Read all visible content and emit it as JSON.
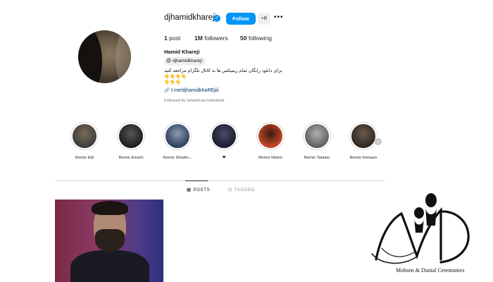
{
  "profile": {
    "username": "djhamidkhareji",
    "verified_mark": "✓",
    "follow_label": "Follow",
    "suggest_label": "+R",
    "more_label": "•••",
    "stats": {
      "posts_value": "1",
      "posts_label": "post",
      "followers_value": "1M",
      "followers_label": "followers",
      "following_value": "50",
      "following_label": "following"
    },
    "full_name": "Hamid Khareji",
    "threads_handle": "djhamidkhareji",
    "bio": "برای دانلود رایگان تمام ریمیکس ها به کانال تلگرام مراجعه کنید\n👇👇👇👇\n👇👇👇",
    "link": "t.me/djhamidkhaREjiii",
    "followed_by": "Followed by leilashirazi.hairstylist"
  },
  "highlights": [
    {
      "label": "Remix Ebi",
      "colors": [
        "#3a3a3a",
        "#7a6a5a"
      ]
    },
    {
      "label": "Remix Emarh",
      "colors": [
        "#1a1a1a",
        "#555555"
      ]
    },
    {
      "label": "Remix Shadm...",
      "colors": [
        "#2a3a5a",
        "#8a9ab0"
      ]
    },
    {
      "label": "❤",
      "colors": [
        "#1a1a2a",
        "#4a4a6a"
      ]
    },
    {
      "label": "Remix Moein",
      "colors": [
        "#d04a2a",
        "#3a1a10"
      ]
    },
    {
      "label": "Remix Tataloo",
      "colors": [
        "#5a5a5a",
        "#b0b0b0"
      ]
    },
    {
      "label": "Remix homaun",
      "colors": [
        "#2a2420",
        "#6a5a4a"
      ]
    }
  ],
  "tabs": {
    "posts_label": "POSTS",
    "tagged_label": "TAGGED"
  },
  "watermark": {
    "caption": "Mohsen & Danial Ceremonies"
  },
  "colors": {
    "accent": "#0095f6",
    "link": "#00376b",
    "muted": "#737373",
    "divider": "#dbdbdb"
  }
}
